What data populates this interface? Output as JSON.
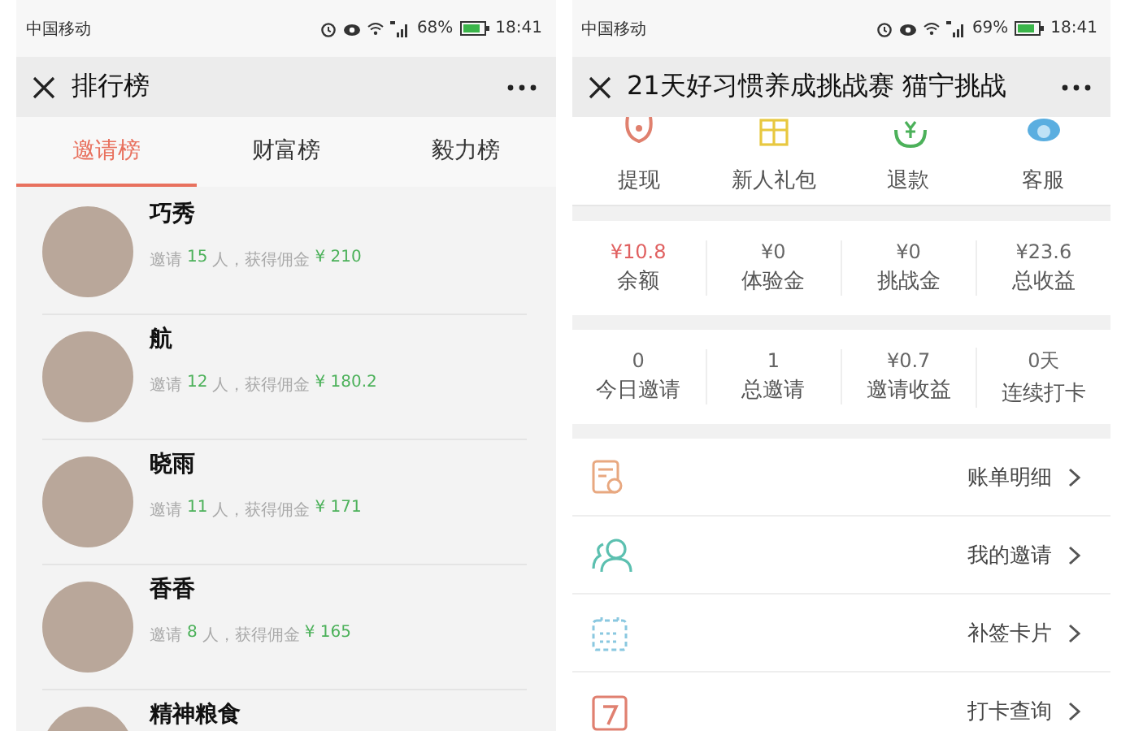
{
  "left": {
    "status_bar": {
      "carrier": "中国移动",
      "battery": "68%",
      "time": "18:41"
    },
    "title": "排行榜",
    "tabs": [
      {
        "label": "邀请榜",
        "selected": true
      },
      {
        "label": "财富榜",
        "selected": false
      },
      {
        "label": "毅力榜",
        "selected": false
      }
    ],
    "ranking": [
      {
        "name": "巧秀",
        "invite_label": "邀请",
        "count": "15",
        "unit_label": "人，获得佣金",
        "reward": "¥ 210"
      },
      {
        "name": "航",
        "invite_label": "邀请",
        "count": "12",
        "unit_label": "人，获得佣金",
        "reward": "¥ 180.2"
      },
      {
        "name": "晓雨",
        "invite_label": "邀请",
        "count": "11",
        "unit_label": "人，获得佣金",
        "reward": "¥ 171"
      },
      {
        "name": "香香",
        "invite_label": "邀请",
        "count": "8",
        "unit_label": "人，获得佣金",
        "reward": "¥ 165"
      },
      {
        "name": "精神粮食"
      }
    ]
  },
  "right": {
    "status_bar": {
      "carrier": "中国移动",
      "battery": "69%",
      "time": "18:41"
    },
    "title": "21天好习惯养成挑战赛 猫宁挑战",
    "shortcuts": [
      {
        "kind": "withdraw",
        "label": "提现"
      },
      {
        "kind": "gift",
        "label": "新人礼包"
      },
      {
        "kind": "refund",
        "label": "退款"
      },
      {
        "kind": "service",
        "label": "客服"
      }
    ],
    "balances": [
      {
        "value": "¥10.8",
        "label": "余额",
        "highlighted": true
      },
      {
        "value": "¥0",
        "label": "体验金",
        "highlighted": false
      },
      {
        "value": "¥0",
        "label": "挑战金",
        "highlighted": false
      },
      {
        "value": "¥23.6",
        "label": "总收益",
        "highlighted": false
      }
    ],
    "invites": [
      {
        "value": "0",
        "label": "今日邀请",
        "highlighted": false
      },
      {
        "value": "1",
        "label": "总邀请",
        "highlighted": false
      },
      {
        "value": "¥0.7",
        "label": "邀请收益",
        "highlighted": false
      },
      {
        "value": "0天",
        "label": "连续打卡",
        "highlighted": false
      }
    ],
    "menu": [
      {
        "kind": "bill",
        "label": "账单明细"
      },
      {
        "kind": "people",
        "label": "我的邀请"
      },
      {
        "kind": "calendar",
        "label": "补签卡片"
      },
      {
        "kind": "day",
        "label": "打卡查询"
      }
    ]
  }
}
